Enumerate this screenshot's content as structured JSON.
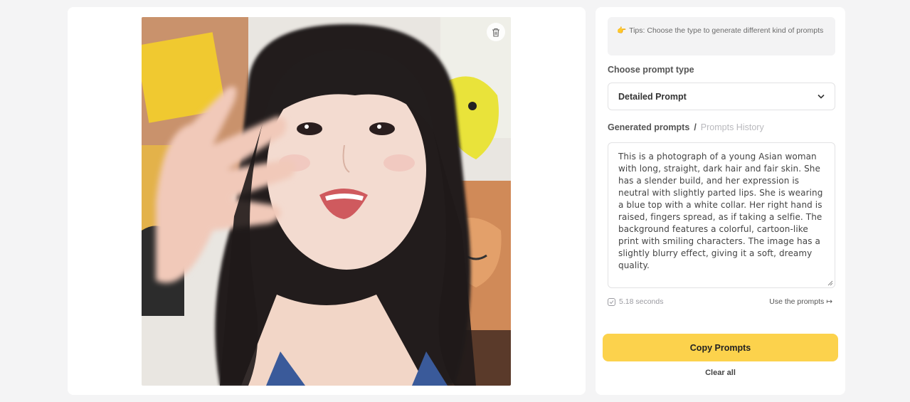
{
  "tips": {
    "icon": "pointing-hand-icon",
    "icon_glyph": "👉",
    "text": "Tips: Choose the type to generate different kind of prompts"
  },
  "prompt_type": {
    "label": "Choose prompt type",
    "selected": "Detailed Prompt"
  },
  "generated": {
    "active_tab": "Generated prompts",
    "separator": "/",
    "history_tab": "Prompts History",
    "text": "This is a photograph of a young Asian woman with long, straight, dark hair and fair skin. She has a slender build, and her expression is neutral with slightly parted lips. She is wearing a blue top with a white collar. Her right hand is raised, fingers spread, as if taking a selfie. The background features a colorful, cartoon-like print with smiling characters. The image has a slightly blurry effect, giving it a soft, dreamy quality.",
    "time": "5.18 seconds",
    "use_link": "Use the prompts ↦"
  },
  "actions": {
    "copy": "Copy Prompts",
    "clear": "Clear all"
  },
  "colors": {
    "accent": "#fcd24c",
    "panel": "#ffffff",
    "background": "#f4f4f5"
  }
}
